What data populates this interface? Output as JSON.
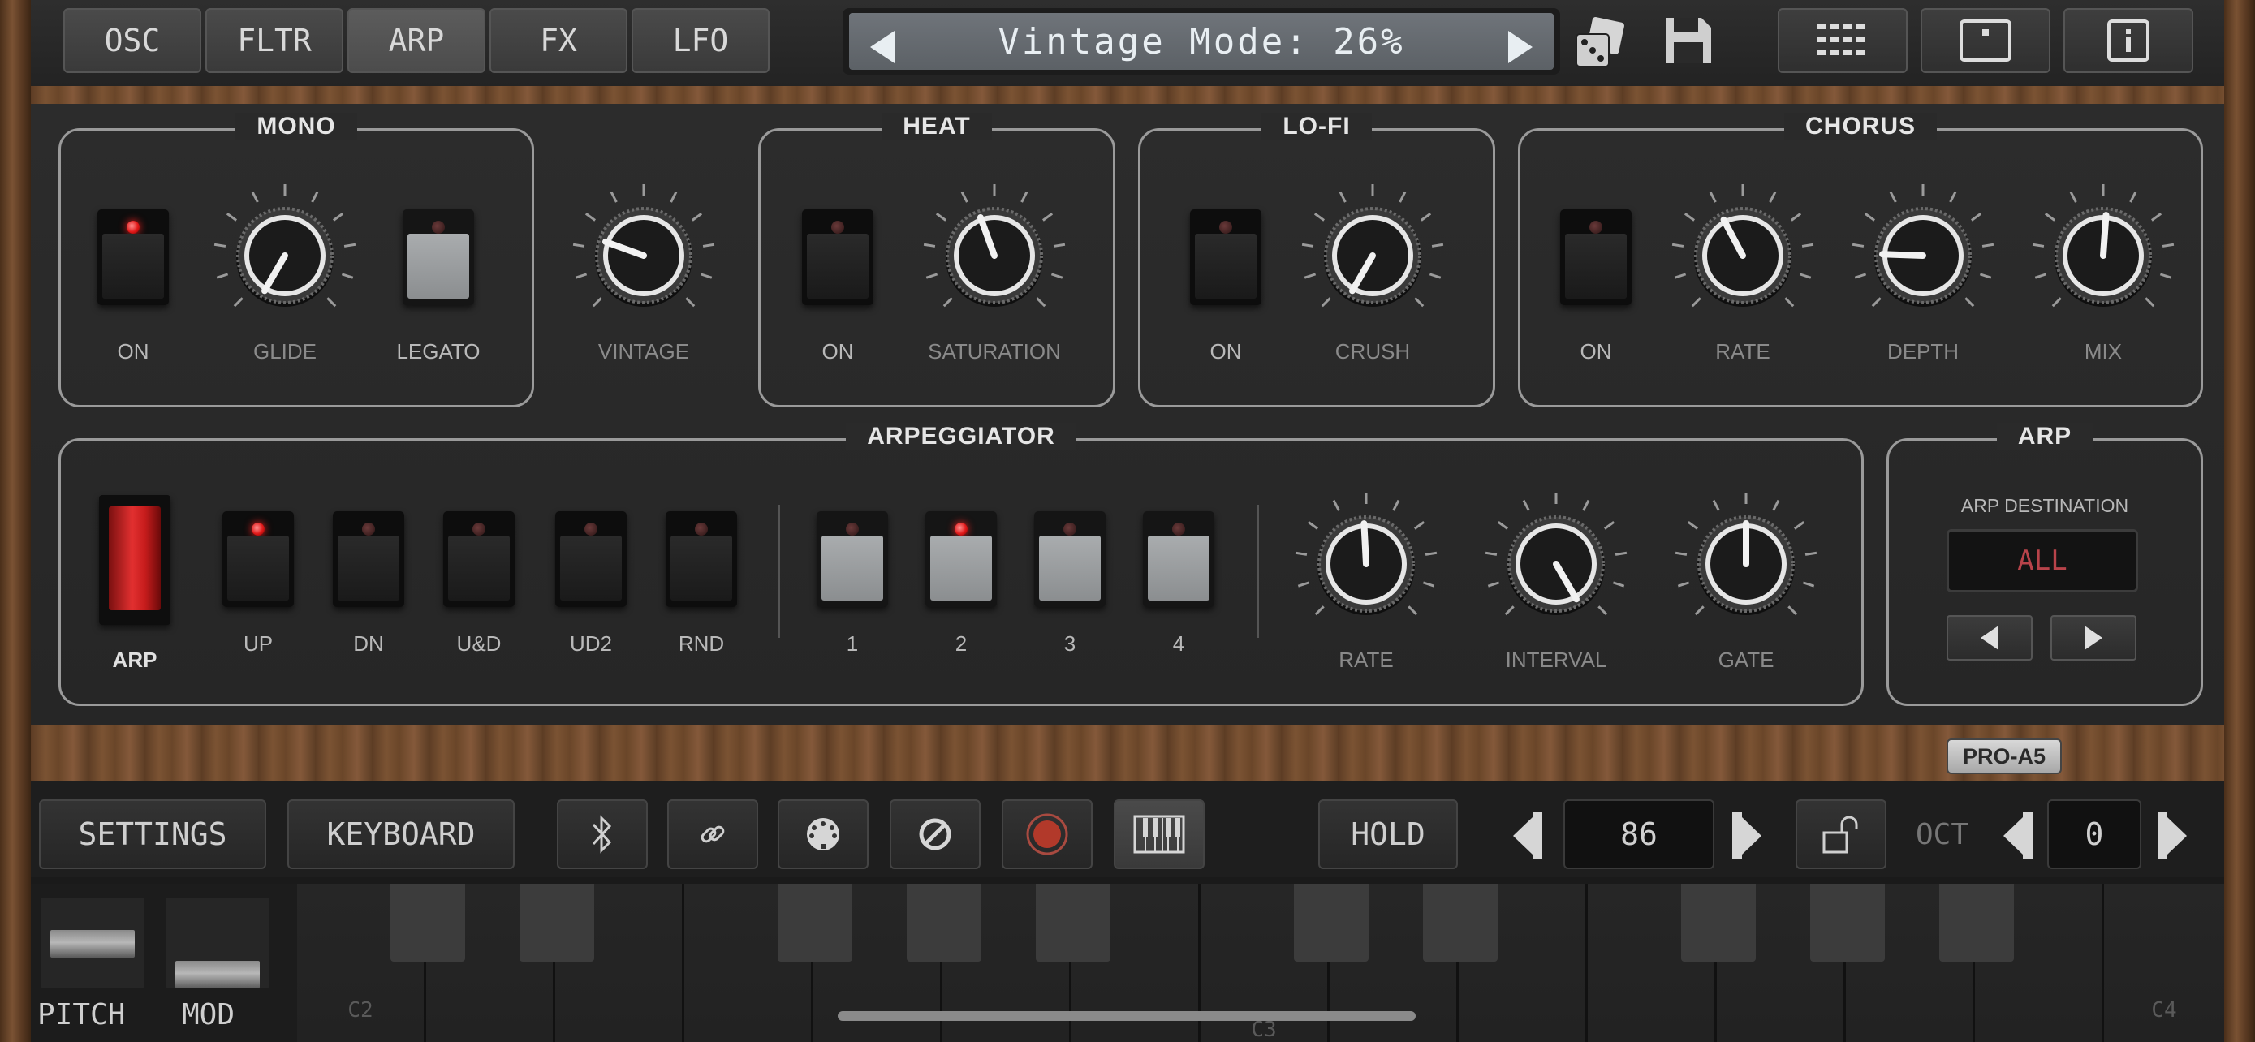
{
  "tabs": [
    "OSC",
    "FLTR",
    "ARP",
    "FX",
    "LFO"
  ],
  "active_tab": "ARP",
  "display": {
    "text": "Vintage Mode: 26%"
  },
  "icons": {
    "dice": "dice-icon",
    "save": "floppy-disk-icon",
    "grid": "grid-icon",
    "panel": "panel-icon",
    "info": "info-icon"
  },
  "mono": {
    "title": "MONO",
    "on": "ON",
    "glide": "GLIDE",
    "legato": "LEGATO"
  },
  "vintage": {
    "label": "VINTAGE"
  },
  "heat": {
    "title": "HEAT",
    "on": "ON",
    "saturation": "SATURATION"
  },
  "lofi": {
    "title": "LO-FI",
    "on": "ON",
    "crush": "CRUSH"
  },
  "chorus": {
    "title": "CHORUS",
    "on": "ON",
    "rate": "RATE",
    "depth": "DEPTH",
    "mix": "MIX"
  },
  "arpeggiator": {
    "title": "ARPEGGIATOR",
    "arp": "ARP",
    "modes": [
      "UP",
      "DN",
      "U&D",
      "UD2",
      "RND"
    ],
    "octaves": [
      "1",
      "2",
      "3",
      "4"
    ],
    "rate": "RATE",
    "interval": "INTERVAL",
    "gate": "GATE"
  },
  "arp_dest": {
    "title": "ARP",
    "label": "ARP DESTINATION",
    "value": "ALL"
  },
  "brand": "PRO-A5",
  "bottom": {
    "settings": "SETTINGS",
    "keyboard": "KEYBOARD",
    "hold": "HOLD",
    "value": "86",
    "oct_label": "OCT",
    "oct_value": "0"
  },
  "wheels": {
    "pitch": "PITCH",
    "mod": "MOD"
  },
  "keys": {
    "c2": "C2",
    "c3": "C3",
    "c4": "C4"
  },
  "colors": {
    "led_on": "#e01818",
    "accent": "#ff2020",
    "lcd": "#6f747a"
  }
}
